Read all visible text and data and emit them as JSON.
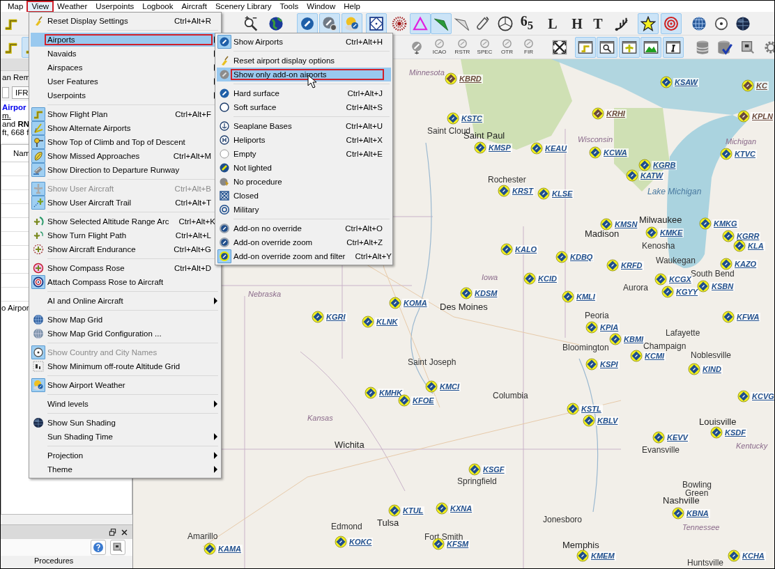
{
  "menu_bar": [
    {
      "label": "Map",
      "selected": false,
      "marked": false
    },
    {
      "label": "View",
      "selected": true,
      "marked": true
    },
    {
      "label": "Weather",
      "selected": false,
      "marked": false
    },
    {
      "label": "Userpoints",
      "selected": false,
      "marked": false
    },
    {
      "label": "Logbook",
      "selected": false,
      "marked": false
    },
    {
      "label": "Aircraft",
      "selected": false,
      "marked": false
    },
    {
      "label": "Scenery Library",
      "selected": false,
      "marked": false
    },
    {
      "label": "Tools",
      "selected": false,
      "marked": false
    },
    {
      "label": "Window",
      "selected": false,
      "marked": false
    },
    {
      "label": "Help",
      "selected": false,
      "marked": false
    }
  ],
  "toolbar_1": [
    {
      "on": false
    },
    {
      "on": false
    },
    {
      "on": false
    },
    {
      "on": true
    },
    {
      "on": true
    },
    {
      "on": true
    },
    {
      "on": true
    },
    {
      "on": false
    },
    {
      "on": true
    },
    {
      "on": true
    },
    {
      "on": false
    },
    {
      "on": false
    },
    {
      "on": false
    },
    {
      "on": false,
      "glyph": "6$_{5}$"
    },
    {
      "on": false,
      "glyph": "L"
    },
    {
      "on": false,
      "glyph": "H"
    },
    {
      "on": false,
      "glyph": "T"
    },
    {
      "on": false
    },
    {
      "on": true
    },
    {
      "on": true
    },
    {
      "on": false
    },
    {
      "on": false
    },
    {
      "on": false
    }
  ],
  "toolbar_2": [
    {
      "on": false
    },
    {
      "on": true
    },
    {
      "on": false
    },
    {
      "on": false,
      "caption": "ICAO"
    },
    {
      "on": false,
      "caption": "RSTR"
    },
    {
      "on": false,
      "caption": "SPEC"
    },
    {
      "on": false,
      "caption": "OTR"
    },
    {
      "on": false,
      "caption": "FIR"
    },
    {
      "on": false
    },
    {
      "on": true
    },
    {
      "on": true
    },
    {
      "on": true
    },
    {
      "on": true
    },
    {
      "on": true
    },
    {
      "on": false
    },
    {
      "on": false
    },
    {
      "on": false
    },
    {
      "on": false
    }
  ],
  "side_panel": {
    "tab": "an Rem",
    "flight_rules": "IFR",
    "airport_link": "Airpor",
    "lines": [
      "m.",
      "and **RN**",
      "ft, 668 f"
    ],
    "column_1": "Nam",
    "row_text": "o Airpor"
  },
  "dock_panel": {
    "tab": "Procedures"
  },
  "view_menu": {
    "items": [
      {
        "kind": "item",
        "label": "Reset Display Settings",
        "shortcut": "Ctrl+Alt+R",
        "submenu": false,
        "disabled": false,
        "selected": false,
        "marked": false
      },
      {
        "kind": "separator"
      },
      {
        "kind": "item",
        "label": "Airports",
        "submenu": true,
        "disabled": false,
        "selected": true,
        "marked": true
      },
      {
        "kind": "item",
        "label": "Navaids",
        "submenu": true,
        "disabled": false,
        "selected": false,
        "marked": false
      },
      {
        "kind": "item",
        "label": "Airspaces",
        "submenu": true,
        "disabled": false,
        "selected": false,
        "marked": false
      },
      {
        "kind": "item",
        "label": "User Features",
        "submenu": true,
        "disabled": false,
        "selected": false,
        "marked": false
      },
      {
        "kind": "item",
        "label": "Userpoints",
        "submenu": true,
        "disabled": false,
        "selected": false,
        "marked": false
      },
      {
        "kind": "separator"
      },
      {
        "kind": "item",
        "label": "Show Flight Plan",
        "shortcut": "Ctrl+Alt+F",
        "submenu": false,
        "disabled": false,
        "selected": false,
        "marked": false,
        "checked": true
      },
      {
        "kind": "item",
        "label": "Show Alternate Airports",
        "submenu": false,
        "disabled": false,
        "selected": false,
        "marked": false,
        "checked": true
      },
      {
        "kind": "item",
        "label": "Show Top of Climb and Top of Descent",
        "submenu": false,
        "disabled": false,
        "selected": false,
        "marked": false,
        "checked": true
      },
      {
        "kind": "item",
        "label": "Show Missed Approaches",
        "shortcut": "Ctrl+Alt+M",
        "submenu": false,
        "disabled": false,
        "selected": false,
        "marked": false,
        "checked": true
      },
      {
        "kind": "item",
        "label": "Show Direction to Departure Runway",
        "submenu": false,
        "disabled": false,
        "selected": false,
        "marked": false,
        "checked": true
      },
      {
        "kind": "separator"
      },
      {
        "kind": "item",
        "label": "Show User Aircraft",
        "shortcut": "Ctrl+Alt+B",
        "submenu": false,
        "disabled": true,
        "selected": false,
        "marked": false,
        "checked": true
      },
      {
        "kind": "item",
        "label": "Show User Aircraft Trail",
        "shortcut": "Ctrl+Alt+T",
        "submenu": false,
        "disabled": false,
        "selected": false,
        "marked": false,
        "checked": true
      },
      {
        "kind": "separator"
      },
      {
        "kind": "item",
        "label": "Show Selected Altitude Range Arc",
        "shortcut": "Ctrl+Alt+K",
        "submenu": false,
        "disabled": false,
        "selected": false,
        "marked": false,
        "checked": false
      },
      {
        "kind": "item",
        "label": "Show Turn Flight Path",
        "shortcut": "Ctrl+Alt+L",
        "submenu": false,
        "disabled": false,
        "selected": false,
        "marked": false,
        "checked": false
      },
      {
        "kind": "item",
        "label": "Show Aircraft Endurance",
        "shortcut": "Ctrl+Alt+G",
        "submenu": false,
        "disabled": false,
        "selected": false,
        "marked": false,
        "checked": false
      },
      {
        "kind": "separator"
      },
      {
        "kind": "item",
        "label": "Show Compass Rose",
        "shortcut": "Ctrl+Alt+D",
        "submenu": false,
        "disabled": false,
        "selected": false,
        "marked": false,
        "checked": false
      },
      {
        "kind": "item",
        "label": "Attach Compass Rose to Aircraft",
        "submenu": false,
        "disabled": false,
        "selected": false,
        "marked": false,
        "checked": true
      },
      {
        "kind": "separator"
      },
      {
        "kind": "item",
        "label": "AI and Online Aircraft",
        "submenu": true,
        "disabled": false,
        "selected": false,
        "marked": false
      },
      {
        "kind": "separator"
      },
      {
        "kind": "item",
        "label": "Show Map Grid",
        "submenu": false,
        "disabled": false,
        "selected": false,
        "marked": false,
        "checked": false
      },
      {
        "kind": "item",
        "label": "Show Map Grid Configuration ...",
        "submenu": false,
        "disabled": false,
        "selected": false,
        "marked": false
      },
      {
        "kind": "separator"
      },
      {
        "kind": "item",
        "label": "Show Country and City Names",
        "submenu": false,
        "disabled": true,
        "selected": false,
        "marked": false,
        "checked": true
      },
      {
        "kind": "item",
        "label": "Show Minimum off-route Altitude Grid",
        "submenu": false,
        "disabled": false,
        "selected": false,
        "marked": false,
        "checked": false
      },
      {
        "kind": "separator"
      },
      {
        "kind": "item",
        "label": "Show Airport Weather",
        "submenu": false,
        "disabled": false,
        "selected": false,
        "marked": false,
        "checked": true
      },
      {
        "kind": "separator"
      },
      {
        "kind": "item",
        "label": "Wind levels",
        "submenu": true,
        "disabled": false,
        "selected": false,
        "marked": false
      },
      {
        "kind": "separator"
      },
      {
        "kind": "item",
        "label": "Show Sun Shading",
        "submenu": false,
        "disabled": false,
        "selected": false,
        "marked": false,
        "checked": false
      },
      {
        "kind": "item",
        "label": "Sun Shading Time",
        "submenu": true,
        "disabled": false,
        "selected": false,
        "marked": false
      },
      {
        "kind": "separator"
      },
      {
        "kind": "item",
        "label": "Projection",
        "submenu": true,
        "disabled": false,
        "selected": false,
        "marked": false
      },
      {
        "kind": "item",
        "label": "Theme",
        "submenu": true,
        "disabled": false,
        "selected": false,
        "marked": false
      }
    ]
  },
  "airports_submenu": {
    "items": [
      {
        "kind": "item",
        "label": "Show Airports",
        "shortcut": "Ctrl+Alt+H",
        "submenu": false,
        "disabled": false,
        "selected": false,
        "marked": false,
        "checked": true
      },
      {
        "kind": "separator"
      },
      {
        "kind": "item",
        "label": "Reset airport display options",
        "submenu": false,
        "disabled": false,
        "selected": false,
        "marked": false
      },
      {
        "kind": "item",
        "label": "Show only add-on airports",
        "submenu": false,
        "disabled": false,
        "selected": true,
        "marked": true,
        "checked": false
      },
      {
        "kind": "separator"
      },
      {
        "kind": "item",
        "label": "Hard surface",
        "shortcut": "Ctrl+Alt+J",
        "submenu": false,
        "disabled": false,
        "selected": false,
        "marked": false,
        "checked": false
      },
      {
        "kind": "item",
        "label": "Soft surface",
        "shortcut": "Ctrl+Alt+S",
        "submenu": false,
        "disabled": false,
        "selected": false,
        "marked": false,
        "checked": false
      },
      {
        "kind": "separator"
      },
      {
        "kind": "item",
        "label": "Seaplane Bases",
        "shortcut": "Ctrl+Alt+U",
        "submenu": false,
        "disabled": false,
        "selected": false,
        "marked": false,
        "checked": false
      },
      {
        "kind": "item",
        "label": "Heliports",
        "shortcut": "Ctrl+Alt+X",
        "submenu": false,
        "disabled": false,
        "selected": false,
        "marked": false,
        "checked": false
      },
      {
        "kind": "item",
        "label": "Empty",
        "shortcut": "Ctrl+Alt+E",
        "submenu": false,
        "disabled": false,
        "selected": false,
        "marked": false,
        "checked": false
      },
      {
        "kind": "item",
        "label": "Not lighted",
        "submenu": false,
        "disabled": false,
        "selected": false,
        "marked": false,
        "checked": false
      },
      {
        "kind": "item",
        "label": "No procedure",
        "submenu": false,
        "disabled": false,
        "selected": false,
        "marked": false,
        "checked": false
      },
      {
        "kind": "item",
        "label": "Closed",
        "submenu": false,
        "disabled": false,
        "selected": false,
        "marked": false,
        "checked": false
      },
      {
        "kind": "item",
        "label": "Military",
        "submenu": false,
        "disabled": false,
        "selected": false,
        "marked": false,
        "checked": false
      },
      {
        "kind": "separator"
      },
      {
        "kind": "item",
        "label": "Add-on no override",
        "shortcut": "Ctrl+Alt+O",
        "submenu": false,
        "disabled": false,
        "selected": false,
        "marked": false,
        "checked": false
      },
      {
        "kind": "item",
        "label": "Add-on override zoom",
        "shortcut": "Ctrl+Alt+Z",
        "submenu": false,
        "disabled": false,
        "selected": false,
        "marked": false,
        "checked": false
      },
      {
        "kind": "item",
        "label": "Add-on override zoom and filter",
        "shortcut": "Ctrl+Alt+Y",
        "submenu": false,
        "disabled": false,
        "selected": false,
        "marked": false,
        "checked": true
      }
    ]
  },
  "map": {
    "airports": [
      {
        "code": "KBRD",
        "color": "#6b4a3c"
      },
      {
        "code": "KSAW",
        "color": "#1f4e8c"
      },
      {
        "code": "KC",
        "color": "#6b4a3c"
      },
      {
        "code": "KSTC",
        "color": "#1f4e8c"
      },
      {
        "code": "KRHI",
        "color": "#6b4a3c"
      },
      {
        "code": "KPLN",
        "color": "#6b4a3c"
      },
      {
        "code": "KMSP",
        "color": "#1f4e8c"
      },
      {
        "code": "KEAU",
        "color": "#1f4e8c"
      },
      {
        "code": "KCWA",
        "color": "#1f4e8c"
      },
      {
        "code": "KTVC",
        "color": "#1f4e8c"
      },
      {
        "code": "KGRB",
        "color": "#1f4e8c"
      },
      {
        "code": "KATW",
        "color": "#1f4e8c"
      },
      {
        "code": "KRST",
        "color": "#1f4e8c"
      },
      {
        "code": "KLSE",
        "color": "#1f4e8c"
      },
      {
        "code": "KMSN",
        "color": "#1f4e8c"
      },
      {
        "code": "KMKG",
        "color": "#1f4e8c"
      },
      {
        "code": "KMKE",
        "color": "#1f4e8c"
      },
      {
        "code": "KGRR",
        "color": "#1f4e8c"
      },
      {
        "code": "KLA",
        "color": "#1f4e8c"
      },
      {
        "code": "KALO",
        "color": "#1f4e8c"
      },
      {
        "code": "KDBQ",
        "color": "#1f4e8c"
      },
      {
        "code": "KRFD",
        "color": "#1f4e8c"
      },
      {
        "code": "KAZO",
        "color": "#1f4e8c"
      },
      {
        "code": "KCGX",
        "color": "#1f4e8c"
      },
      {
        "code": "KGYY",
        "color": "#1f4e8c"
      },
      {
        "code": "KSBN",
        "color": "#1f4e8c"
      },
      {
        "code": "KCID",
        "color": "#1f4e8c"
      },
      {
        "code": "KMLI",
        "color": "#1f4e8c"
      },
      {
        "code": "KDSM",
        "color": "#1f4e8c"
      },
      {
        "code": "KOMA",
        "color": "#1f4e8c"
      },
      {
        "code": "KGRI",
        "color": "#1f4e8c"
      },
      {
        "code": "KLNK",
        "color": "#1f4e8c"
      },
      {
        "code": "KPIA",
        "color": "#1f4e8c"
      },
      {
        "code": "KBMI",
        "color": "#1f4e8c"
      },
      {
        "code": "KCMI",
        "color": "#1f4e8c"
      },
      {
        "code": "KFWA",
        "color": "#1f4e8c"
      },
      {
        "code": "KSPI",
        "color": "#1f4e8c"
      },
      {
        "code": "KIND",
        "color": "#1f4e8c"
      },
      {
        "code": "KMCI",
        "color": "#1f4e8c"
      },
      {
        "code": "KMHK",
        "color": "#1f4e8c"
      },
      {
        "code": "KFOE",
        "color": "#1f4e8c"
      },
      {
        "code": "KSTL",
        "color": "#1f4e8c"
      },
      {
        "code": "KBLV",
        "color": "#1f4e8c"
      },
      {
        "code": "KCVG",
        "color": "#1f4e8c"
      },
      {
        "code": "KEVV",
        "color": "#1f4e8c"
      },
      {
        "code": "KSDF",
        "color": "#1f4e8c"
      },
      {
        "code": "KSGF",
        "color": "#1f4e8c"
      },
      {
        "code": "KTUL",
        "color": "#1f4e8c"
      },
      {
        "code": "KXNA",
        "color": "#1f4e8c"
      },
      {
        "code": "KFSM",
        "color": "#1f4e8c"
      },
      {
        "code": "KOKC",
        "color": "#1f4e8c"
      },
      {
        "code": "KAMA",
        "color": "#1f4e8c"
      },
      {
        "code": "KBNA",
        "color": "#1f4e8c"
      },
      {
        "code": "KMEM",
        "color": "#1f4e8c"
      },
      {
        "code": "KCHA",
        "color": "#1f4e8c"
      }
    ],
    "places": [
      {
        "name": "Minnesota",
        "kind": "region"
      },
      {
        "name": "Saint Cloud",
        "kind": "city"
      },
      {
        "name": "Saint Paul",
        "kind": "major"
      },
      {
        "name": "Rochester",
        "kind": "city"
      },
      {
        "name": "Wisconsin",
        "kind": "region"
      },
      {
        "name": "Lake Michigan",
        "kind": "water"
      },
      {
        "name": "Michigan",
        "kind": "region"
      },
      {
        "name": "Milwaukee",
        "kind": "major"
      },
      {
        "name": "Madison",
        "kind": "major"
      },
      {
        "name": "Kenosha",
        "kind": "city"
      },
      {
        "name": "Waukegan",
        "kind": "city"
      },
      {
        "name": "South Bend",
        "kind": "city"
      },
      {
        "name": "Aurora",
        "kind": "city"
      },
      {
        "name": "Iowa",
        "kind": "region"
      },
      {
        "name": "Des Moines",
        "kind": "major"
      },
      {
        "name": "Nebraska",
        "kind": "region"
      },
      {
        "name": "Peoria",
        "kind": "city"
      },
      {
        "name": "Bloomington",
        "kind": "city"
      },
      {
        "name": "Lafayette",
        "kind": "city"
      },
      {
        "name": "Champaign",
        "kind": "city"
      },
      {
        "name": "Noblesville",
        "kind": "city"
      },
      {
        "name": "Saint Joseph",
        "kind": "city"
      },
      {
        "name": "Columbia",
        "kind": "city"
      },
      {
        "name": "Kansas",
        "kind": "region"
      },
      {
        "name": "Wichita",
        "kind": "major"
      },
      {
        "name": "Springfield",
        "kind": "city"
      },
      {
        "name": "Evansville",
        "kind": "city"
      },
      {
        "name": "Louisville",
        "kind": "major"
      },
      {
        "name": "Kentucky",
        "kind": "region"
      },
      {
        "name": "Bowling",
        "kind": "city"
      },
      {
        "name": "Green",
        "kind": "city"
      },
      {
        "name": "Nashville",
        "kind": "major"
      },
      {
        "name": "Edmond",
        "kind": "city"
      },
      {
        "name": "Tulsa",
        "kind": "major"
      },
      {
        "name": "Jonesboro",
        "kind": "city"
      },
      {
        "name": "Tennessee",
        "kind": "region"
      },
      {
        "name": "Amarillo",
        "kind": "city"
      },
      {
        "name": "Fort Smith",
        "kind": "city"
      },
      {
        "name": "Memphis",
        "kind": "major"
      },
      {
        "name": "Huntsville",
        "kind": "city"
      }
    ]
  }
}
